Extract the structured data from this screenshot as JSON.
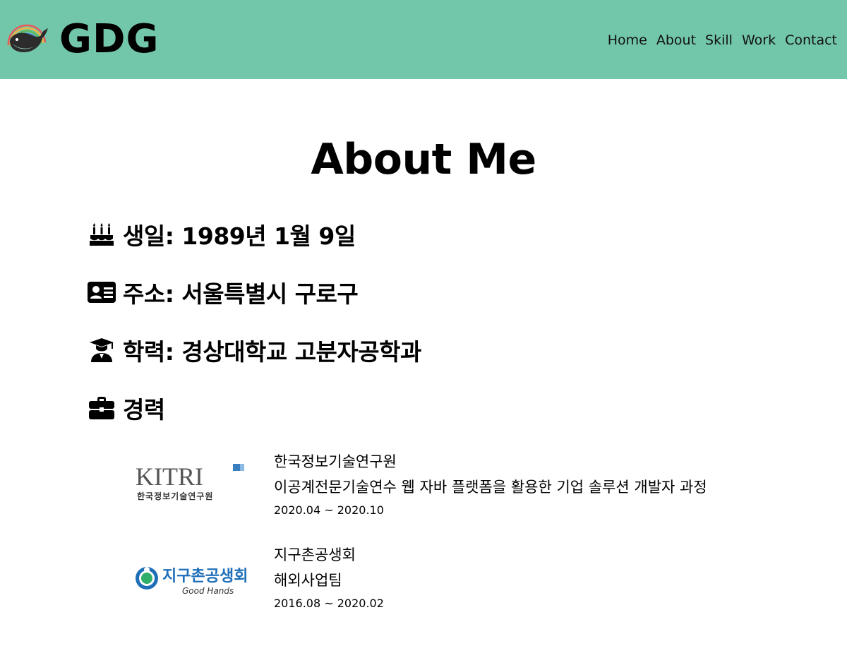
{
  "navbar": {
    "brand": "GDG",
    "menu": [
      "Home",
      "About",
      "Skill",
      "Work",
      "Contact"
    ]
  },
  "about": {
    "title": "About Me",
    "items": [
      {
        "icon": "birthday-cake-icon",
        "text": "생일: 1989년 1월 9일"
      },
      {
        "icon": "id-card-icon",
        "text": "주소: 서울특별시 구로구"
      },
      {
        "icon": "graduate-icon",
        "text": "학력: 경상대학교 고분자공학과"
      },
      {
        "icon": "briefcase-icon",
        "text": "경력"
      }
    ]
  },
  "career": [
    {
      "logo_text": "KITRI",
      "logo_subtext": "한국정보기술연구원",
      "org": "한국정보기술연구원",
      "role": "이공계전문기술연수 웹 자바 플랫폼을 활용한 기업 솔루션 개발자 과정",
      "period": "2020.04 ~ 2020.10"
    },
    {
      "logo_text": "지구촌공생회",
      "logo_subtext": "Good Hands",
      "org": "지구촌공생회",
      "role": "해외사업팀",
      "period": "2016.08 ~ 2020.02"
    }
  ],
  "colors": {
    "navbar_bg": "#72c6aa",
    "kitri_blue": "#3a7ec0",
    "goodhands_blue": "#1f6fb8"
  }
}
